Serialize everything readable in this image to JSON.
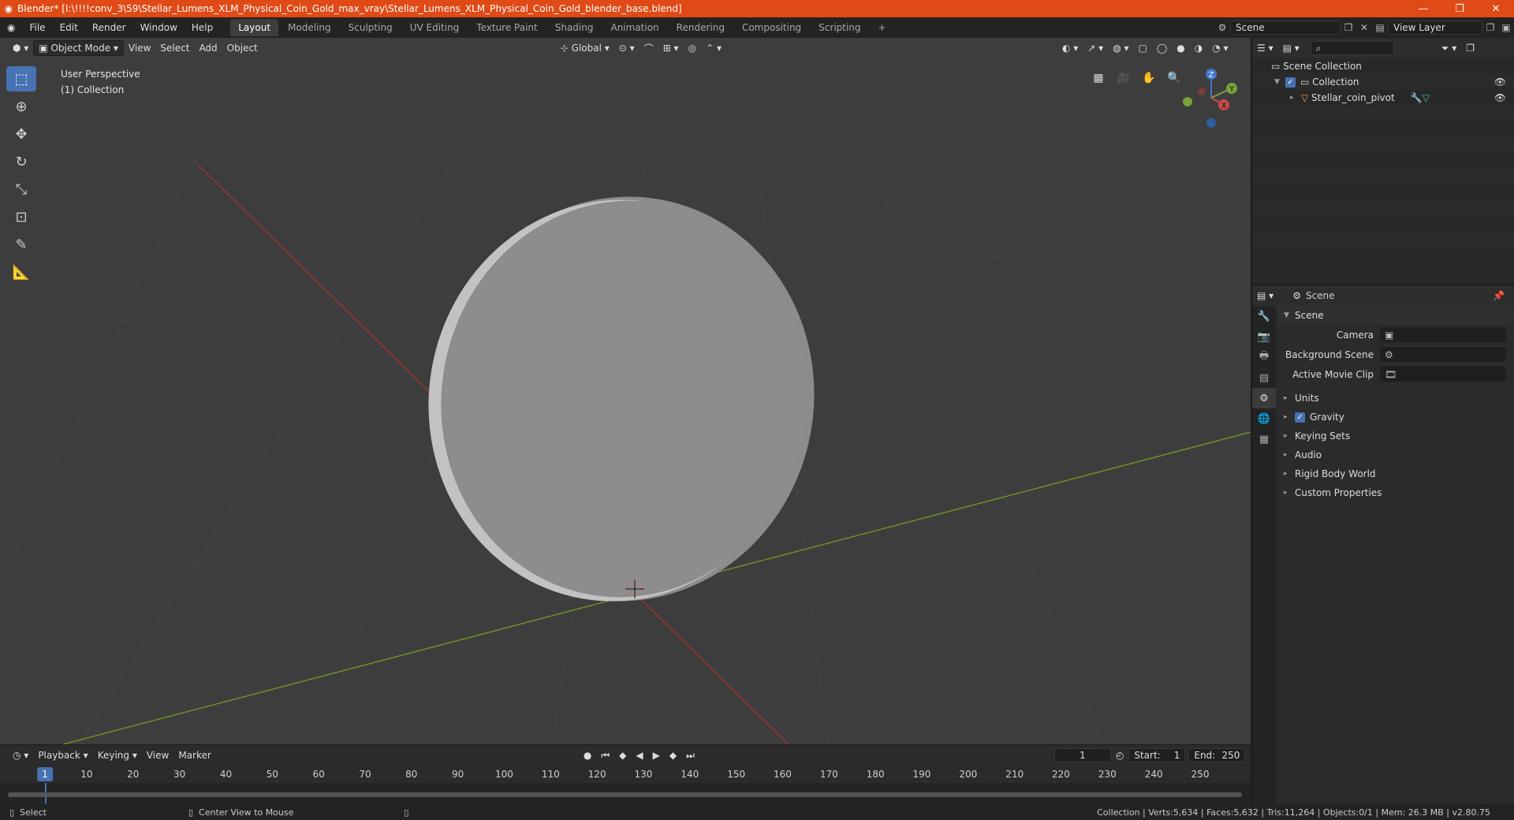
{
  "titlebar": {
    "title": "Blender* [I:\\!!!!conv_3\\59\\Stellar_Lumens_XLM_Physical_Coin_Gold_max_vray\\Stellar_Lumens_XLM_Physical_Coin_Gold_blender_base.blend]",
    "minimize": "—",
    "maximize": "❐",
    "close": "✕"
  },
  "menu": {
    "file": "File",
    "edit": "Edit",
    "render": "Render",
    "window": "Window",
    "help": "Help"
  },
  "workspaces": [
    "Layout",
    "Modeling",
    "Sculpting",
    "UV Editing",
    "Texture Paint",
    "Shading",
    "Animation",
    "Rendering",
    "Compositing",
    "Scripting"
  ],
  "workspace_add": "+",
  "scene_field": "Scene",
  "viewlayer_field": "View Layer",
  "viewport_header": {
    "mode": "Object Mode",
    "view": "View",
    "select": "Select",
    "add": "Add",
    "object": "Object",
    "orientation": "Global"
  },
  "viewport_info": {
    "perspective": "User Perspective",
    "collection": "(1) Collection"
  },
  "gizmo": {
    "z": "Z",
    "y": "Y",
    "x": "X"
  },
  "outliner": {
    "root": "Scene Collection",
    "collection": "Collection",
    "object": "Stellar_coin_pivot"
  },
  "properties": {
    "header": "Scene",
    "panel": "Scene",
    "camera_label": "Camera",
    "bg_scene_label": "Background Scene",
    "movie_clip_label": "Active Movie Clip",
    "subpanels": [
      "Units",
      "Gravity",
      "Keying Sets",
      "Audio",
      "Rigid Body World",
      "Custom Properties"
    ]
  },
  "timeline": {
    "playback": "Playback",
    "keying": "Keying",
    "view": "View",
    "marker": "Marker",
    "current_frame": "1",
    "start_label": "Start:",
    "start": "1",
    "end_label": "End:",
    "end": "250",
    "ticks": [
      "10",
      "20",
      "30",
      "40",
      "50",
      "60",
      "70",
      "80",
      "90",
      "100",
      "110",
      "120",
      "130",
      "140",
      "150",
      "160",
      "170",
      "180",
      "190",
      "200",
      "210",
      "220",
      "230",
      "240",
      "250"
    ],
    "playhead": "1"
  },
  "statusbar": {
    "select": "Select",
    "center": "Center View to Mouse",
    "stats": "Collection | Verts:5,634 | Faces:5,632 | Tris:11,264 | Objects:0/1 | Mem: 26.3 MB | v2.80.75"
  },
  "colors": {
    "titlebar": "#e04a16",
    "accent": "#4772b3",
    "viewport_bg": "#3d3d3d",
    "x_axis": "#b13b3b",
    "y_axis": "#7fa229"
  }
}
